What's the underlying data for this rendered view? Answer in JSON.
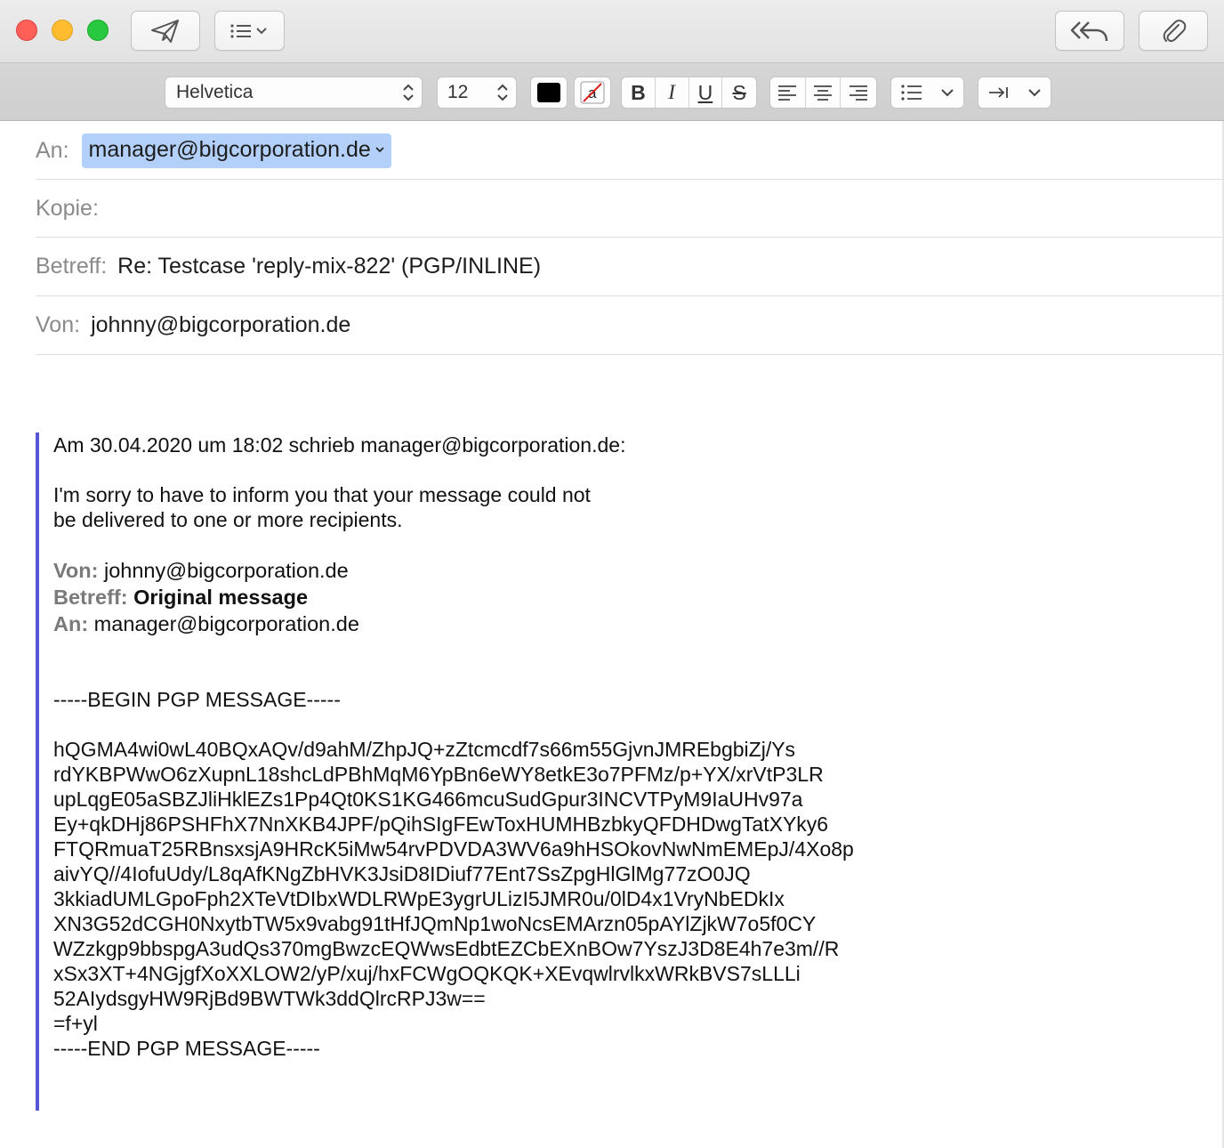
{
  "toolbar": {
    "font_name": "Helvetica",
    "font_size": "12",
    "text_color": "#000000",
    "style_buttons": [
      "B",
      "I",
      "U",
      "S"
    ],
    "accent_colors": {
      "recipient_token": "#b3d0fb",
      "quote_bar": "#5856d6"
    }
  },
  "icons": {
    "send": "paper-plane-icon",
    "header_fields": "list-chevron-icon",
    "reply_all": "reply-all-icon",
    "attach": "paperclip-icon"
  },
  "headers": {
    "to_label": "An:",
    "to_value": "manager@bigcorporation.de",
    "cc_label": "Kopie:",
    "subject_label": "Betreff:",
    "subject_value": "Re: Testcase 'reply-mix-822' (PGP/INLINE)",
    "from_label": "Von:",
    "from_value": "johnny@bigcorporation.de"
  },
  "body": {
    "attribution": "Am 30.04.2020 um 18:02 schrieb manager@bigcorporation.de:",
    "intro_lines": [
      "I'm sorry to have to inform you that your message could not",
      "be delivered to one or more recipients."
    ],
    "forwarded": {
      "from_label": "Von:",
      "from_value": " johnny@bigcorporation.de",
      "subject_label": "Betreff:",
      "subject_value": " Original message",
      "to_label": "An:",
      "to_value": " manager@bigcorporation.de"
    },
    "pgp_begin": "-----BEGIN PGP MESSAGE-----",
    "pgp_lines": [
      "hQGMA4wi0wL40BQxAQv/d9ahM/ZhpJQ+zZtcmcdf7s66m55GjvnJMREbgbiZj/Ys",
      "rdYKBPWwO6zXupnL18shcLdPBhMqM6YpBn6eWY8etkE3o7PFMz/p+YX/xrVtP3LR",
      "upLqgE05aSBZJliHklEZs1Pp4Qt0KS1KG466mcuSudGpur3INCVTPyM9IaUHv97a",
      "Ey+qkDHj86PSHFhX7NnXKB4JPF/pQihSIgFEwToxHUMHBzbkyQFDHDwgTatXYky6",
      "FTQRmuaT25RBnsxsjA9HRcK5iMw54rvPDVDA3WV6a9hHSOkovNwNmEMEpJ/4Xo8p",
      "aivYQ//4IofuUdy/L8qAfKNgZbHVK3JsiD8IDiuf77Ent7SsZpgHlGlMg77zO0JQ",
      "3kkiadUMLGpoFph2XTeVtDIbxWDLRWpE3ygrULizI5JMR0u/0lD4x1VryNbEDkIx",
      "XN3G52dCGH0NxytbTW5x9vabg91tHfJQmNp1woNcsEMArzn05pAYlZjkW7o5f0CY",
      "WZzkgp9bbspgA3udQs370mgBwzcEQWwsEdbtEZCbEXnBOw7YszJ3D8E4h7e3m//R",
      "xSx3XT+4NGjgfXoXXLOW2/yP/xuj/hxFCWgOQKQK+XEvqwlrvlkxWRkBVS7sLLLi",
      "52AIydsgyHW9RjBd9BWTWk3ddQlrcRPJ3w==",
      "=f+yl"
    ],
    "pgp_end": "-----END PGP MESSAGE-----"
  }
}
